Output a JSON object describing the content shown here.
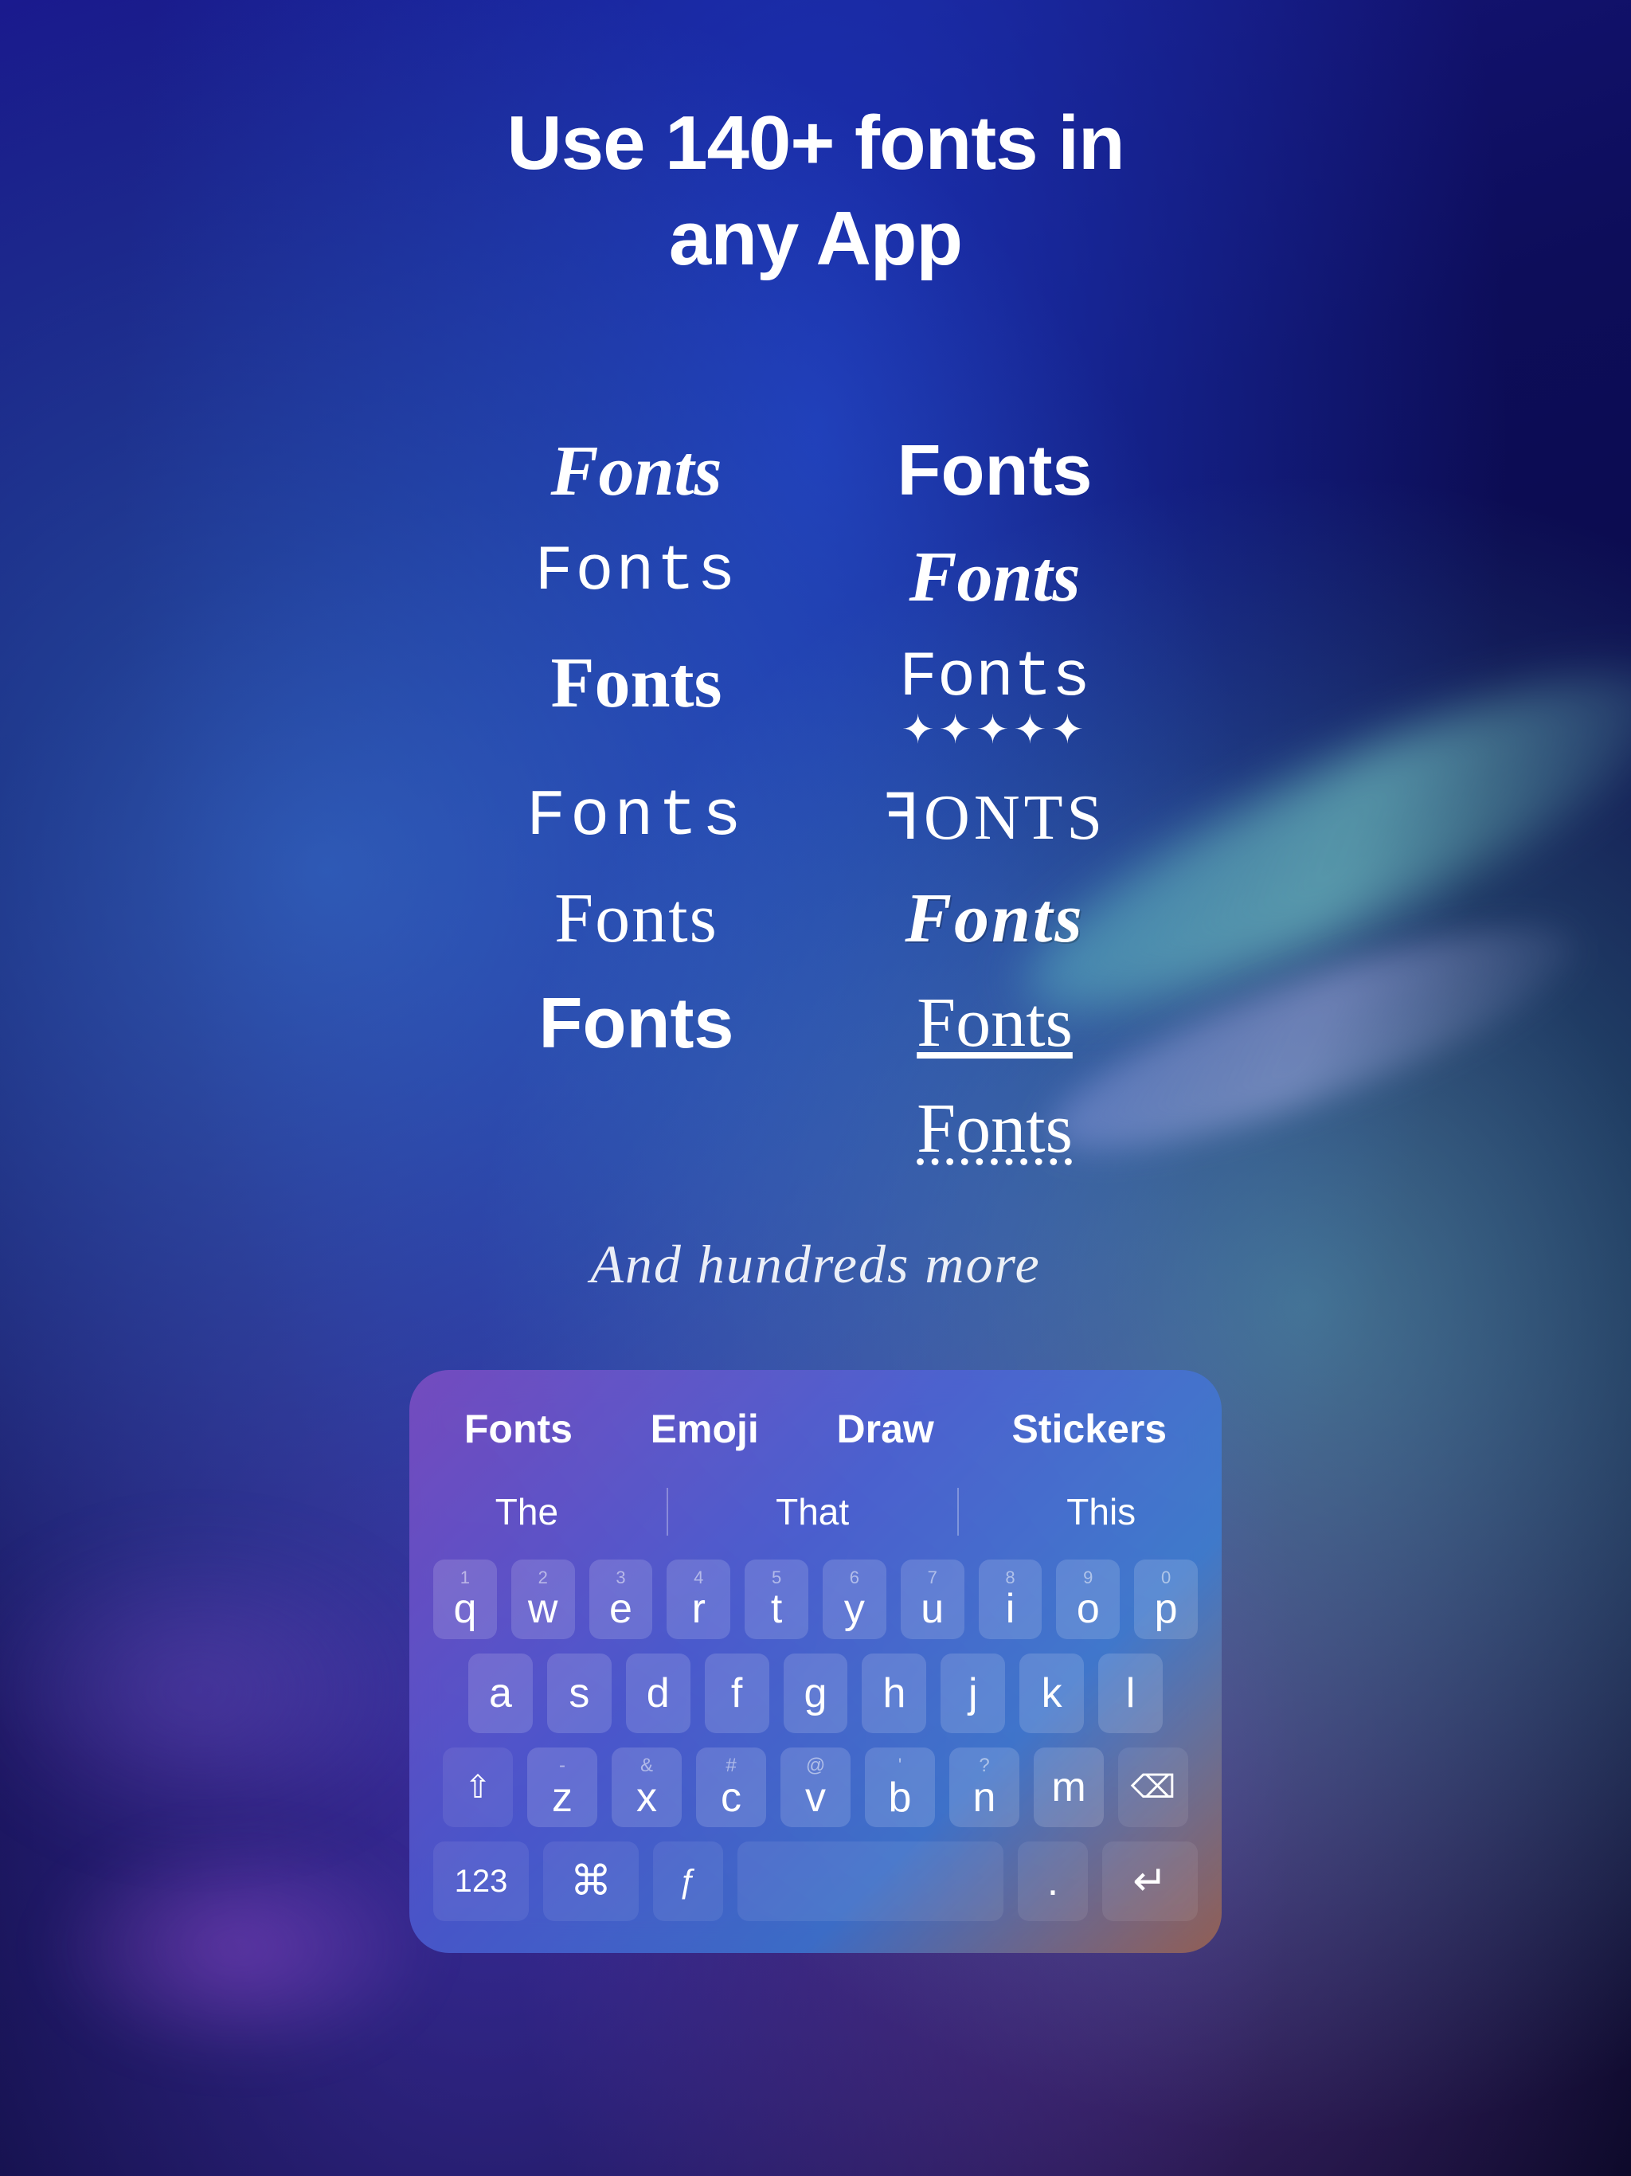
{
  "header": {
    "title": "Use 140+ fonts in\nany App"
  },
  "fontSamples": [
    {
      "text": "Fonts",
      "style": "script",
      "label": "script-font"
    },
    {
      "text": "Fonts",
      "style": "bold-sans",
      "label": "bold-sans-font"
    },
    {
      "text": "Fonts",
      "style": "monospace",
      "label": "monospace-font"
    },
    {
      "text": "Fonts",
      "style": "bold-italic",
      "label": "bold-italic-font"
    },
    {
      "text": "Fonts",
      "style": "serif-bold",
      "label": "serif-bold-font"
    },
    {
      "text": "Fonts\n*****",
      "style": "serif-stars",
      "label": "serif-stars-font"
    },
    {
      "text": "Fonts",
      "style": "thin-wide",
      "label": "thin-wide-font"
    },
    {
      "text": "ꟻONTS",
      "style": "decorative",
      "label": "decorative-font"
    },
    {
      "text": "Fonts",
      "style": "thin",
      "label": "thin-font"
    },
    {
      "text": "Fonts",
      "style": "gothic",
      "label": "gothic-font"
    },
    {
      "text": "Fonts",
      "style": "sans-bold",
      "label": "sans-bold-font"
    },
    {
      "text": "Fonts",
      "style": "underline",
      "label": "underline-font"
    },
    {
      "text": "",
      "style": "empty",
      "label": "empty"
    },
    {
      "text": "Fonts",
      "style": "dotted-underline",
      "label": "dotted-underline-font"
    }
  ],
  "tagline": "And hundreds more",
  "keyboard": {
    "tabs": [
      {
        "label": "Fonts",
        "active": true
      },
      {
        "label": "Emoji",
        "active": false
      },
      {
        "label": "Draw",
        "active": false
      },
      {
        "label": "Stickers",
        "active": false
      }
    ],
    "suggestions": [
      "The",
      "That",
      "This"
    ],
    "rows": {
      "row1": [
        "q",
        "w",
        "e",
        "r",
        "t",
        "y",
        "u",
        "i",
        "o",
        "p"
      ],
      "row1nums": [
        "1",
        "2",
        "3",
        "4",
        "5",
        "6",
        "7",
        "8",
        "9",
        "0"
      ],
      "row2": [
        "a",
        "s",
        "d",
        "f",
        "g",
        "h",
        "j",
        "k",
        "l"
      ],
      "row3": [
        "z",
        "x",
        "c",
        "v",
        "b",
        "n",
        "m"
      ],
      "row3syms": [
        "-",
        "&",
        "#",
        "@",
        "'",
        "?"
      ]
    },
    "specialKeys": {
      "shift": "⇧",
      "delete": "⌫",
      "num": "123",
      "cmd": "⌘",
      "func": "ƒ",
      "period": ".",
      "return": "↵"
    }
  }
}
